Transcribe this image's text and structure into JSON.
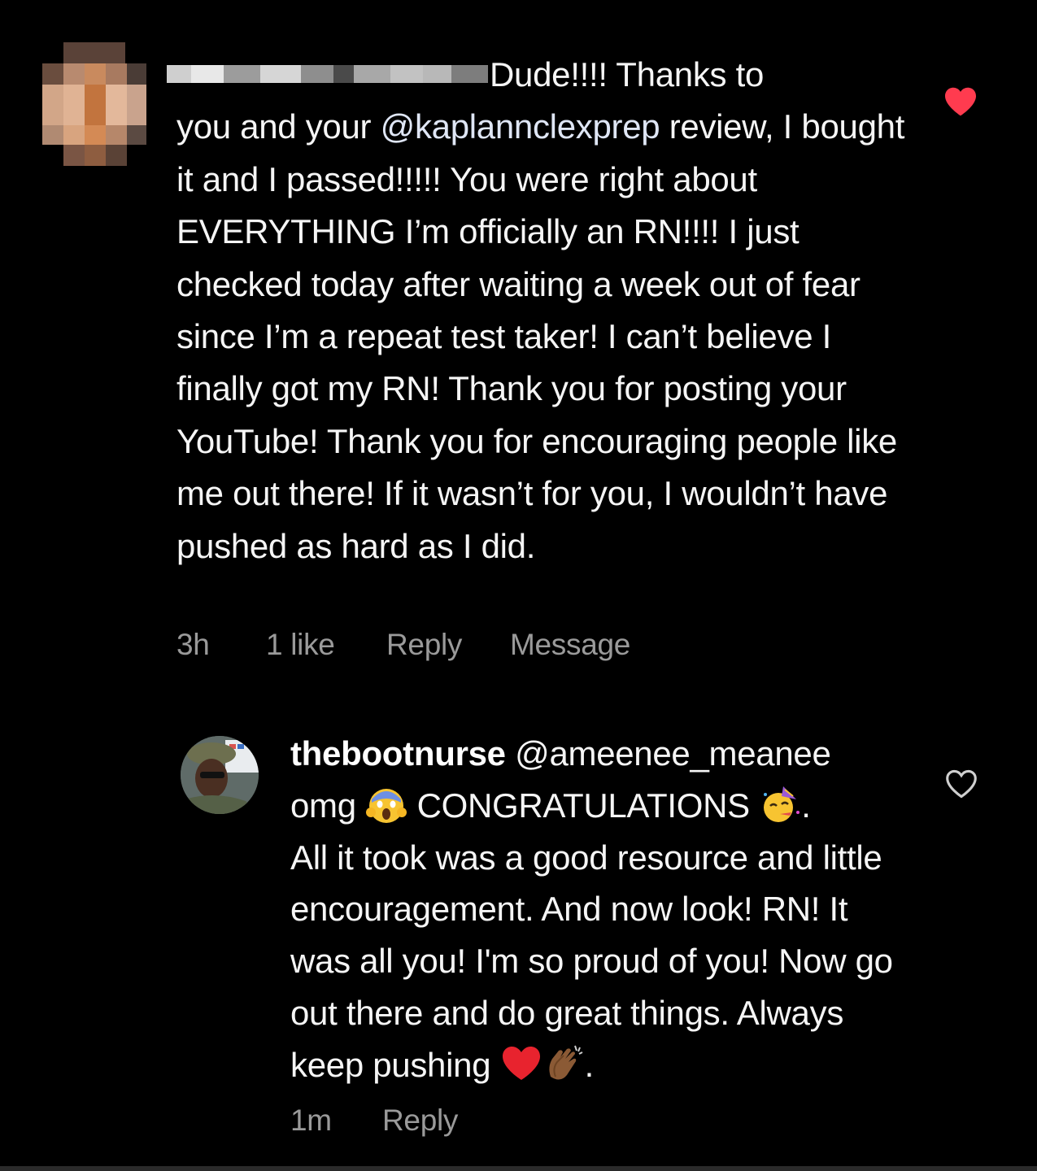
{
  "comment1": {
    "text_line1": "Dude!!!! Thanks to",
    "text_pre": "you and your ",
    "mention": "@kaplannclexprep",
    "text_post": " review, I bought it and I passed!!!!! You were right about EVERYTHING I’m officially an RN!!!! I just checked today after waiting a week out of fear since I’m a repeat test taker! I can’t believe I finally got my RN! Thank you for posting your YouTube! Thank you for encouraging people like me out there! If it wasn’t for you, I wouldn’t have pushed as hard as I did.",
    "time": "3h",
    "likes": "1 like",
    "reply_label": "Reply",
    "message_label": "Message",
    "liked": true
  },
  "comment2": {
    "username": "thebootnurse",
    "mention": "@ameenee_meanee",
    "text_a": "omg",
    "text_b": "CONGRATULATIONS",
    "text_c": ".",
    "text_d": "All it took was a good resource and little encouragement. And now look! RN! It was all you! I'm so proud of you! Now go out there and do great things. Always keep pushing",
    "text_e": ".",
    "time": "1m",
    "reply_label": "Reply",
    "liked": false
  },
  "icons": {
    "heart_filled": "heart-filled-icon",
    "heart_outline": "heart-outline-icon",
    "emoji_scream": "face-screaming-in-fear-emoji",
    "emoji_party": "partying-face-emoji",
    "emoji_heart": "red-heart-emoji",
    "emoji_clap": "clapping-hands-emoji"
  },
  "colors": {
    "background": "#000000",
    "text": "#f5f5f5",
    "muted": "#9a9a9a",
    "like_red": "#ff3b4f"
  }
}
